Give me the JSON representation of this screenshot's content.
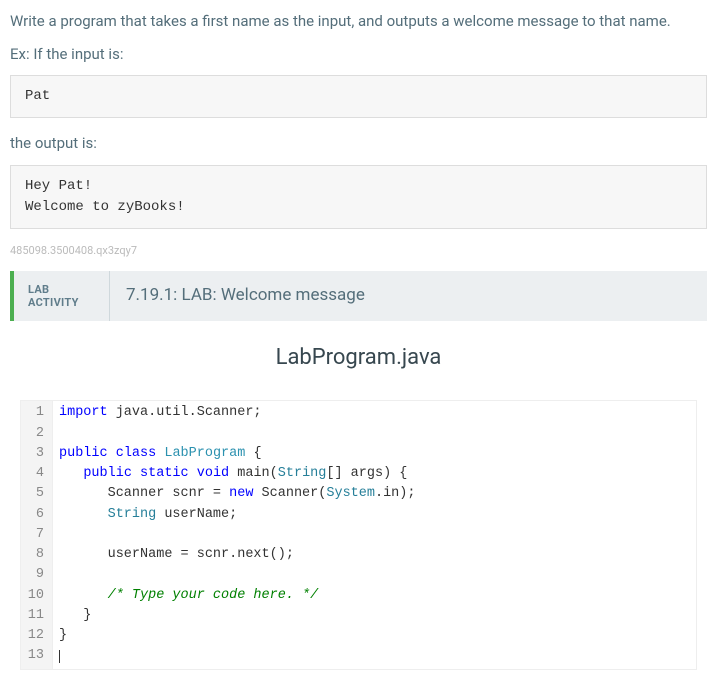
{
  "instruction": {
    "line1": "Write a program that takes a first name as the input, and outputs a welcome message to that name.",
    "line2": "Ex: If the input is:",
    "input_example": "Pat",
    "output_label": "the output is:",
    "output_example": "Hey Pat!\nWelcome to zyBooks!"
  },
  "hash_id": "485098.3500408.qx3zqy7",
  "lab": {
    "label_line1": "LAB",
    "label_line2": "ACTIVITY",
    "title": "7.19.1: LAB: Welcome message"
  },
  "file_name": "LabProgram.java",
  "code": {
    "line_count": 13,
    "lines": [
      {
        "tokens": [
          {
            "t": "import",
            "c": "kw-blue"
          },
          {
            "t": " java.util.Scanner;",
            "c": ""
          }
        ]
      },
      {
        "tokens": []
      },
      {
        "tokens": [
          {
            "t": "public",
            "c": "kw-blue"
          },
          {
            "t": " ",
            "c": ""
          },
          {
            "t": "class",
            "c": "kw-blue"
          },
          {
            "t": " ",
            "c": ""
          },
          {
            "t": "LabProgram",
            "c": "kw-classname"
          },
          {
            "t": " {",
            "c": ""
          }
        ]
      },
      {
        "tokens": [
          {
            "t": "   ",
            "c": ""
          },
          {
            "t": "public",
            "c": "kw-blue"
          },
          {
            "t": " ",
            "c": ""
          },
          {
            "t": "static",
            "c": "kw-blue"
          },
          {
            "t": " ",
            "c": ""
          },
          {
            "t": "void",
            "c": "kw-blue"
          },
          {
            "t": " main(",
            "c": ""
          },
          {
            "t": "String",
            "c": "kw-type"
          },
          {
            "t": "[] args) {",
            "c": ""
          }
        ]
      },
      {
        "tokens": [
          {
            "t": "      Scanner scnr = ",
            "c": ""
          },
          {
            "t": "new",
            "c": "kw-blue"
          },
          {
            "t": " Scanner(",
            "c": ""
          },
          {
            "t": "System",
            "c": "kw-type"
          },
          {
            "t": ".in);",
            "c": ""
          }
        ]
      },
      {
        "tokens": [
          {
            "t": "      ",
            "c": ""
          },
          {
            "t": "String",
            "c": "kw-type"
          },
          {
            "t": " userName;",
            "c": ""
          }
        ]
      },
      {
        "tokens": []
      },
      {
        "tokens": [
          {
            "t": "      userName = scnr.next();",
            "c": ""
          }
        ]
      },
      {
        "tokens": []
      },
      {
        "tokens": [
          {
            "t": "      ",
            "c": ""
          },
          {
            "t": "/* Type your code here. */",
            "c": "kw-comment"
          }
        ]
      },
      {
        "tokens": [
          {
            "t": "   }",
            "c": ""
          }
        ]
      },
      {
        "tokens": [
          {
            "t": "}",
            "c": ""
          }
        ]
      },
      {
        "tokens": []
      }
    ]
  }
}
